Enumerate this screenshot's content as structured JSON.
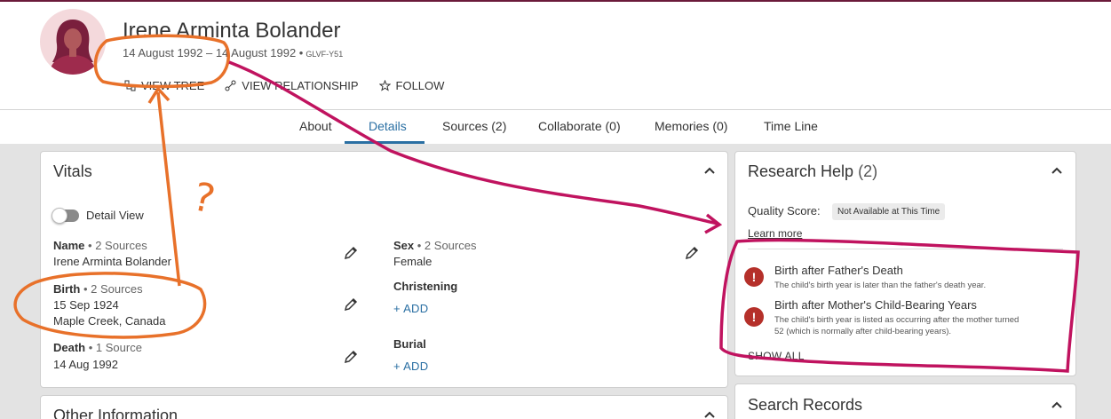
{
  "person": {
    "name": "Irene Arminta Bolander",
    "dates": "14 August 1992 – 14 August 1992 •",
    "pid": "GLVF-Y51"
  },
  "actions": [
    {
      "label": "VIEW TREE",
      "icon": "tree-icon"
    },
    {
      "label": "VIEW RELATIONSHIP",
      "icon": "relationship-icon"
    },
    {
      "label": "FOLLOW",
      "icon": "star-icon"
    }
  ],
  "tabs": [
    {
      "label": "About"
    },
    {
      "label": "Details"
    },
    {
      "label": "Sources (2)"
    },
    {
      "label": "Collaborate (0)"
    },
    {
      "label": "Memories (0)"
    },
    {
      "label": "Time Line"
    }
  ],
  "active_tab": "Details",
  "vitals": {
    "title": "Vitals",
    "detail_view": "Detail View",
    "name": {
      "label": "Name",
      "sources": "• 2 Sources",
      "value": "Irene Arminta Bolander"
    },
    "sex": {
      "label": "Sex",
      "sources": "• 2 Sources",
      "value": "Female"
    },
    "birth": {
      "label": "Birth",
      "sources": "• 2 Sources",
      "date": "15 Sep 1924",
      "place": "Maple Creek, Canada"
    },
    "christening": {
      "label": "Christening",
      "add": "+ ADD"
    },
    "death": {
      "label": "Death",
      "sources": "• 1 Source",
      "value": "14 Aug 1992"
    },
    "burial": {
      "label": "Burial",
      "add": "+ ADD"
    }
  },
  "other_info": {
    "title": "Other Information"
  },
  "research_help": {
    "title": "Research Help",
    "count": "(2)",
    "quality_label": "Quality Score:",
    "quality_badge": "Not Available at This Time",
    "learn_more": "Learn more",
    "alerts": [
      {
        "title": "Birth after Father's Death",
        "desc": "The child's birth year is later than the father's death year."
      },
      {
        "title": "Birth after Mother's Child-Bearing Years",
        "desc1": "The child's birth year is listed as occurring after the mother turned",
        "desc2": "52 (which is normally after child-bearing years)."
      }
    ],
    "show_all": "SHOW ALL"
  },
  "search_records": {
    "title": "Search Records"
  },
  "annotations": {
    "question_mark": "?"
  },
  "colors": {
    "accent": "#2a6fa3",
    "alert": "#b5302a",
    "annotation_orange": "#e8712a",
    "annotation_magenta": "#c0135f"
  }
}
